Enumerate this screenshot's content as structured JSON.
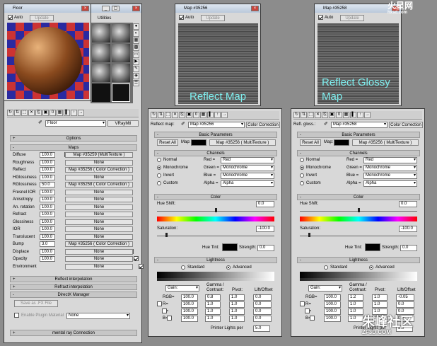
{
  "matEditor": {
    "title": "Floor",
    "menu_utilities": "Utilities",
    "material_name": "Floor",
    "material_type": "VRayMtl",
    "rollouts": {
      "options": "Options",
      "maps": "Maps",
      "reflect_interp": "Reflect interpolation",
      "refract_interp": "Refract interpolation",
      "directx": "DirectX Manager",
      "mental_ray": "mental ray Connection"
    },
    "maps": [
      {
        "label": "Diffuse",
        "value": "100.0",
        "map": "Map #35259  (MultiTexture )"
      },
      {
        "label": "Roughness",
        "value": "100.0",
        "map": "None"
      },
      {
        "label": "Reflect",
        "value": "100.0",
        "map": "Map #35256  ( Color Correction )"
      },
      {
        "label": "HGlossiness",
        "value": "100.0",
        "map": "None"
      },
      {
        "label": "RGlossiness",
        "value": "50.0",
        "map": "Map #35258  ( Color Correction )"
      },
      {
        "label": "Fresnel IOR",
        "value": "100.0",
        "map": "None"
      },
      {
        "label": "Anisotropy",
        "value": "100.0",
        "map": "None"
      },
      {
        "label": "An. rotation",
        "value": "100.0",
        "map": "None"
      },
      {
        "label": "Refract",
        "value": "100.0",
        "map": "None"
      },
      {
        "label": "Glossiness",
        "value": "100.0",
        "map": "None"
      },
      {
        "label": "IOR",
        "value": "100.0",
        "map": "None"
      },
      {
        "label": "Translucent",
        "value": "100.0",
        "map": "None"
      },
      {
        "label": "Bump",
        "value": "3.0",
        "map": "Map #35256  ( Color Correction )"
      },
      {
        "label": "Displace",
        "value": "100.0",
        "map": "None"
      },
      {
        "label": "Opacity",
        "value": "100.0",
        "map": "None"
      },
      {
        "label": "Environment",
        "value": "",
        "map": "None"
      }
    ],
    "save_fx": "Save as .FX File",
    "enable_plugin": "Enable Plugin Material",
    "plugin_value": "None"
  },
  "preview1": {
    "title": "Map #35256",
    "auto": "Auto",
    "update": "Update",
    "caption": "Reflect Map"
  },
  "preview2": {
    "title": "Map #35258",
    "auto": "Auto",
    "update": "Update",
    "caption": "Reflect Glossy Map"
  },
  "cc1": {
    "label": "Reflect map:",
    "map": "Map #35256",
    "type": "Color Correction",
    "map_full": "Map #35256  ( MultiTexture )"
  },
  "cc2": {
    "label": "Refl. gloss.:",
    "map": "Map #35258",
    "type": "Color Correction",
    "map_full": "Map #35256  ( MultiTexture )"
  },
  "cc": {
    "basic": "Basic Parameters",
    "reset": "Reset All",
    "map_lbl": "Map:",
    "channels": "Channels",
    "normal": "Normal",
    "mono": "Monochrome",
    "invert": "Invert",
    "custom": "Custom",
    "red": "Red =",
    "green": "Green =",
    "blue": "Blue =",
    "alpha": "Alpha =",
    "red_v": "Red",
    "mono_v": "Monochrome",
    "alpha_v": "Alpha",
    "color": "Color",
    "hue_shift": "Hue Shift:",
    "hue_shift_v": "0.0",
    "saturation": "Saturation:",
    "saturation_v": "-100.0",
    "hue_tint": "Hue Tint:",
    "strength": "Strength:",
    "strength_v": "0.0",
    "lightness": "Lightness",
    "standard": "Standard",
    "advanced": "Advanced",
    "gain": "Gain:",
    "gamma": "Gamma /",
    "contrast": "Contrast:",
    "pivot": "Pivot:",
    "lift": "Lift/Offset",
    "rgb": "RGB=",
    "r": "R=",
    "g": "G=",
    "b": "B=",
    "printer": "Printer Lights per",
    "printer_v": "5.0"
  },
  "cc1_vals": {
    "gain": [
      "100.0",
      "100.0",
      "100.0",
      "100.0"
    ],
    "gamma": [
      "0.8",
      "1.0",
      "1.0",
      "1.0"
    ],
    "pivot": [
      "1.0",
      "1.0",
      "1.0",
      "1.0"
    ],
    "lift": [
      "0.0",
      "0.0",
      "0.0",
      "0.0"
    ]
  },
  "cc2_vals": {
    "gain": [
      "100.0",
      "100.0",
      "100.0",
      "100.0"
    ],
    "gamma": [
      "1.2",
      "1.0",
      "1.0",
      "1.0"
    ],
    "pivot": [
      "1.0",
      "1.0",
      "1.0",
      "1.0"
    ],
    "lift": [
      "-0.05",
      "0.0",
      "0.0",
      "0.0"
    ]
  },
  "watermark": {
    "top": "火星网",
    "top_sub": "hxsd.com",
    "bottom": "朱峰社区",
    "bottom_sub": "ZF3D.COM"
  }
}
